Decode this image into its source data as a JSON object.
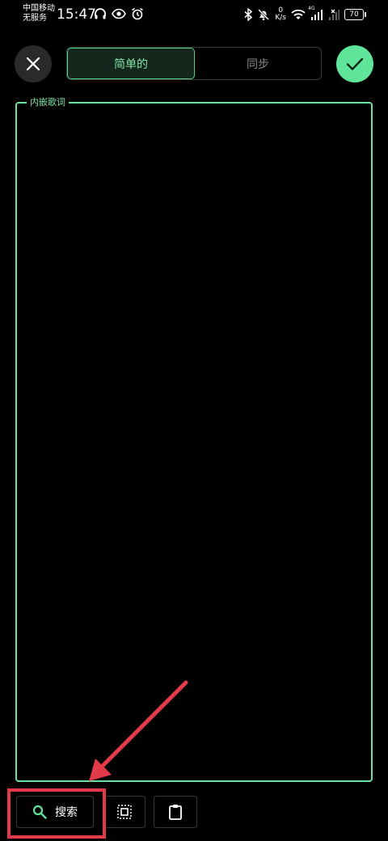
{
  "status_bar": {
    "carrier_line1": "中国移动",
    "carrier_line2": "无服务",
    "time": "15:47",
    "net_speed_value": "0",
    "net_speed_unit": "K/s",
    "network_type": "4G",
    "battery": "70",
    "icons": [
      "headphones-icon",
      "eye-icon",
      "alarm-icon",
      "bluetooth-icon",
      "mute-icon",
      "wifi-icon",
      "signal-icon"
    ]
  },
  "header": {
    "tabs": [
      {
        "label": "简单的",
        "active": true
      },
      {
        "label": "同步",
        "active": false
      }
    ],
    "close_icon": "close-icon",
    "confirm_icon": "check-icon"
  },
  "lyrics": {
    "label": "内嵌歌词",
    "value": ""
  },
  "toolbar": {
    "search_label": "搜索",
    "search_icon": "search-icon",
    "select_icon": "select-all-icon",
    "paste_icon": "clipboard-icon"
  },
  "colors": {
    "accent": "#5fe59a",
    "annotation": "#e23a48",
    "background": "#000000"
  }
}
